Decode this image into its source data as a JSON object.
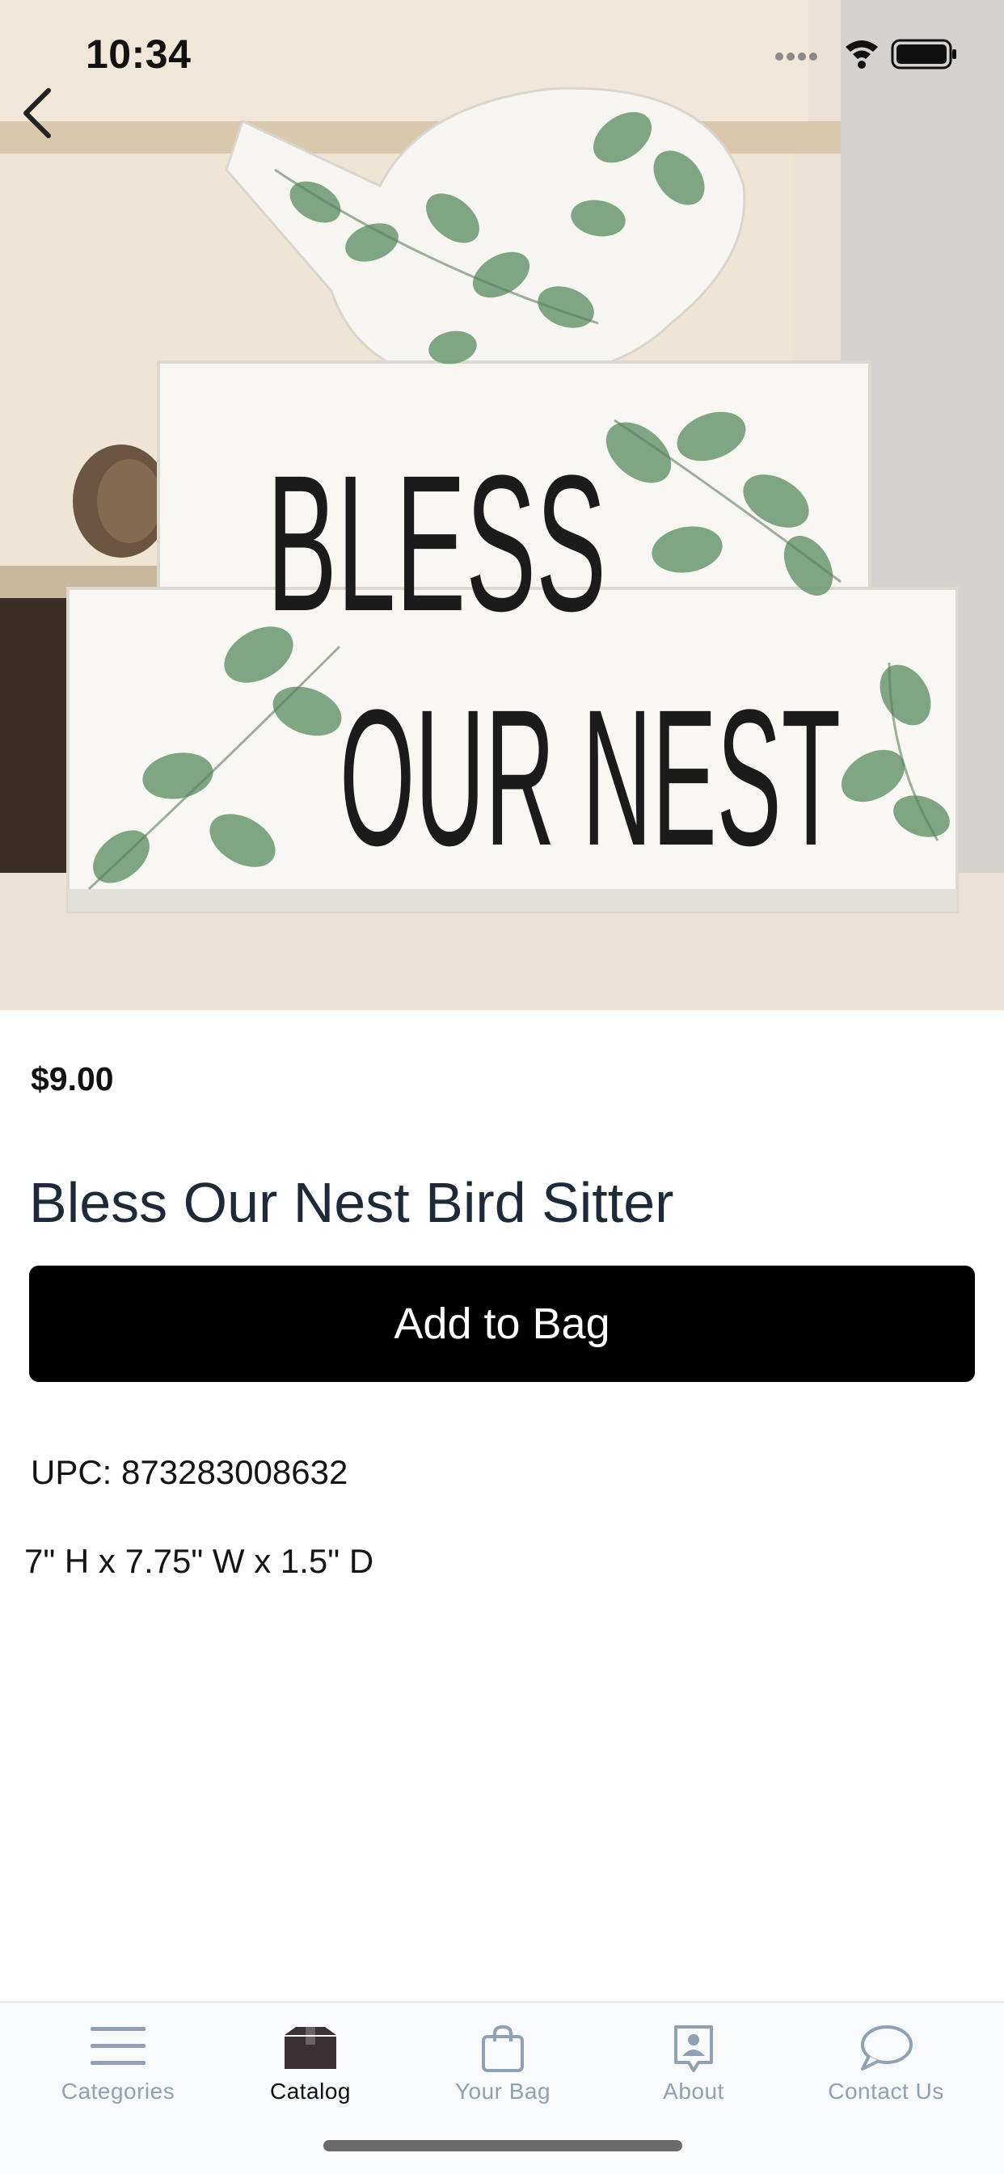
{
  "status_bar": {
    "time": "10:34"
  },
  "product": {
    "image_text": [
      "BLESS",
      "OUR NEST"
    ],
    "price": "$9.00",
    "title": "Bless Our Nest Bird Sitter",
    "add_to_bag_label": "Add to Bag",
    "upc": "UPC: 873283008632",
    "dimensions": "7\" H x 7.75\" W x 1.5\" D"
  },
  "tabs": [
    {
      "label": "Categories",
      "icon": "menu-lines-icon",
      "active": false
    },
    {
      "label": "Catalog",
      "icon": "box-icon",
      "active": true
    },
    {
      "label": "Your Bag",
      "icon": "shopping-bag-icon",
      "active": false
    },
    {
      "label": "About",
      "icon": "person-card-icon",
      "active": false
    },
    {
      "label": "Contact Us",
      "icon": "speech-bubble-icon",
      "active": false
    }
  ],
  "colors": {
    "button_bg": "#000000",
    "tab_active": "#111111",
    "tab_inactive": "#8fa1b3",
    "leaf_green": "#6f9a74"
  }
}
